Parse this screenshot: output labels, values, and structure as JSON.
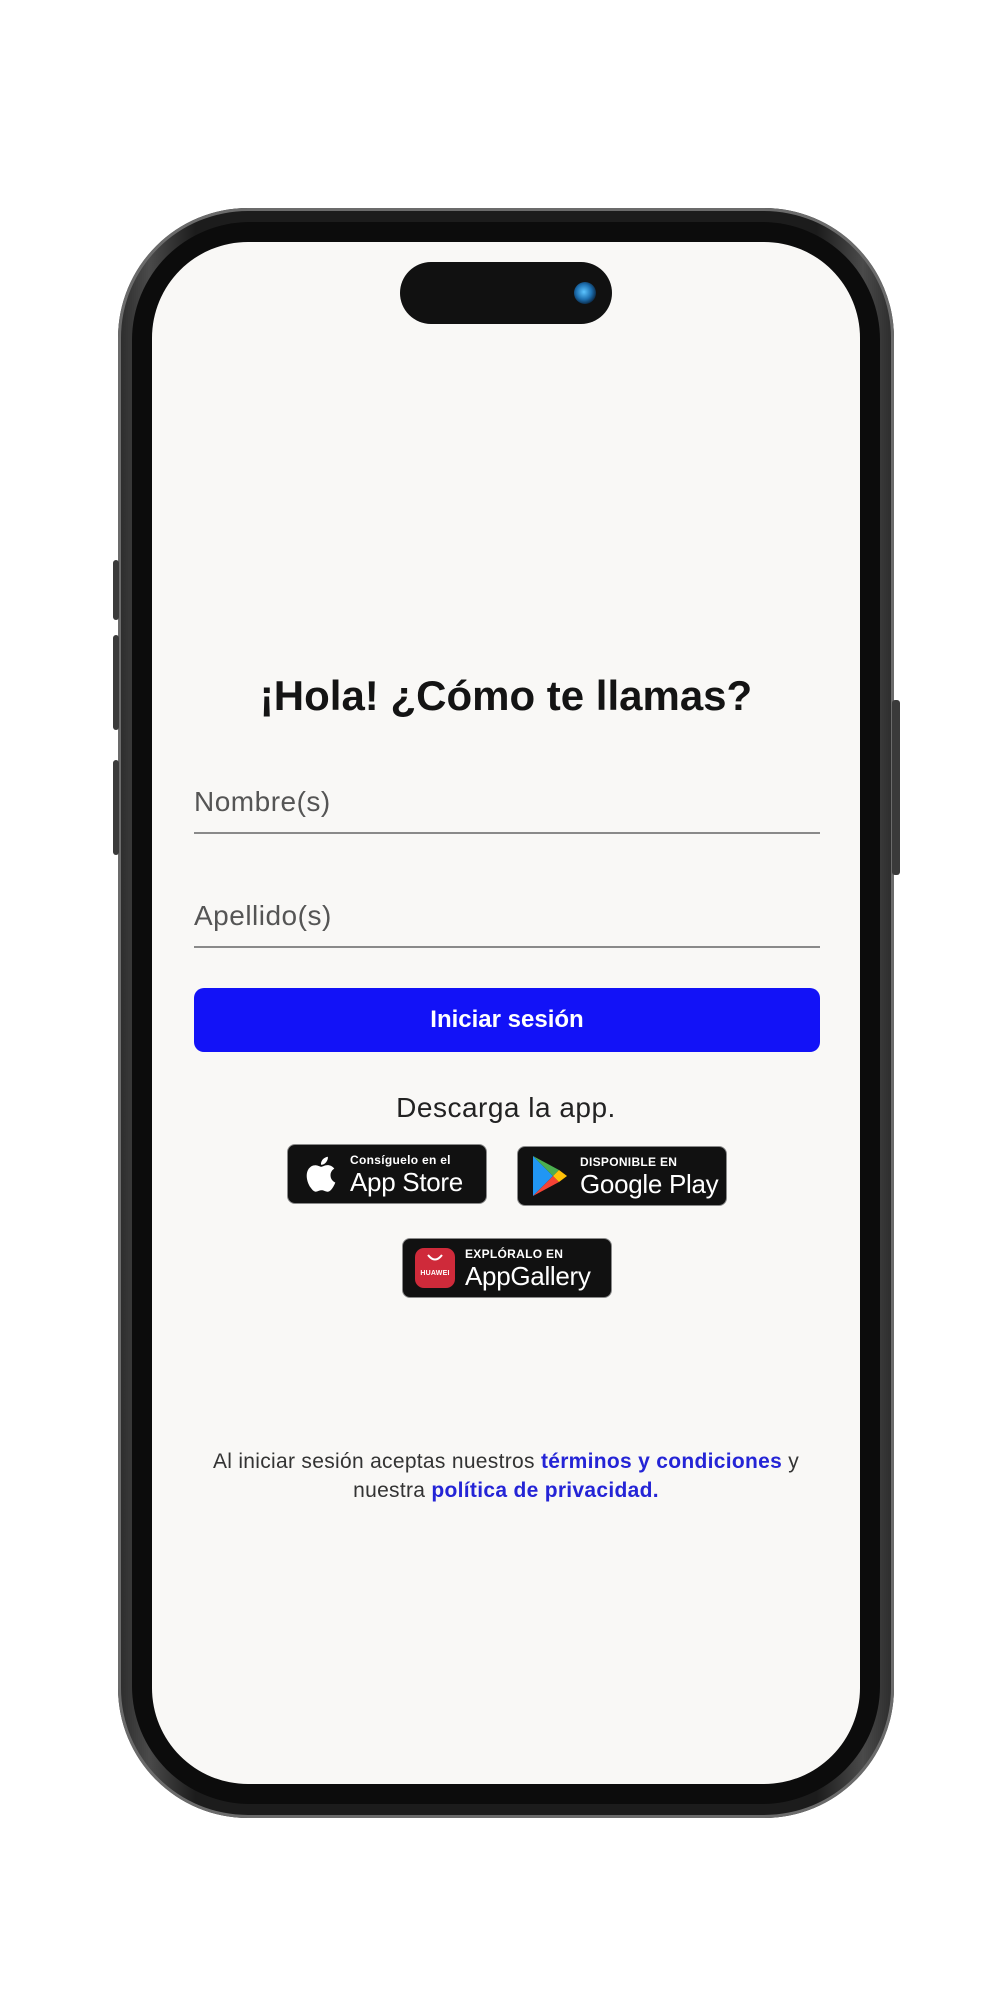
{
  "screen": {
    "title": "¡Hola! ¿Cómo te llamas?",
    "first_name_placeholder": "Nombre(s)",
    "last_name_placeholder": "Apellido(s)",
    "login_button": "Iniciar sesión",
    "download_label": "Descarga la app."
  },
  "stores": {
    "apple": {
      "small": "Consíguelo en el",
      "big": "App Store",
      "icon": "apple-logo-icon"
    },
    "google": {
      "small": "DISPONIBLE EN",
      "big": "Google Play",
      "icon": "google-play-icon"
    },
    "huawei": {
      "small": "EXPLÓRALO EN",
      "big": "AppGallery",
      "icon": "huawei-appgallery-icon",
      "icon_text": "HUAWEI"
    }
  },
  "legal": {
    "prefix": "Al iniciar sesión aceptas nuestros",
    "terms_link": "términos y condiciones",
    "middle": "y nuestra",
    "privacy_link": "política de privacidad."
  },
  "colors": {
    "primary": "#1212f7",
    "link": "#2424d6",
    "background": "#f9f8f6"
  }
}
